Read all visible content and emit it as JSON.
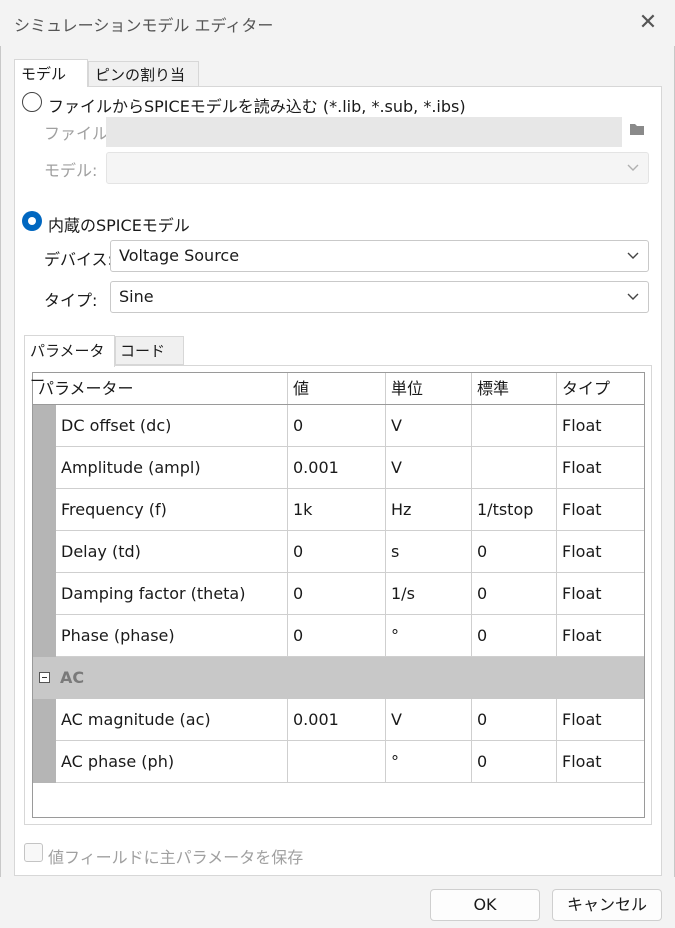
{
  "window": {
    "title": "シミュレーションモデル エディター"
  },
  "tabs": {
    "model": "モデル",
    "pins": "ピンの割り当て"
  },
  "file_source": {
    "radio_label": "ファイルからSPICEモデルを読み込む (*.lib, *.sub, *.ibs)",
    "file_label": "ファイル:",
    "file_value": "",
    "model_label": "モデル:",
    "model_value": ""
  },
  "builtin": {
    "radio_label": "内蔵のSPICEモデル",
    "device_label": "デバイス:",
    "device_value": "Voltage Source",
    "type_label": "タイプ:",
    "type_value": "Sine"
  },
  "inner_tabs": {
    "params": "パラメーター",
    "code": "コード"
  },
  "grid": {
    "headers": [
      "パラメーター",
      "値",
      "単位",
      "標準",
      "タイプ"
    ],
    "rows": [
      {
        "name": "DC offset (dc)",
        "value": "0",
        "unit": "V",
        "default": "",
        "type": "Float"
      },
      {
        "name": "Amplitude (ampl)",
        "value": "0.001",
        "unit": "V",
        "default": "",
        "type": "Float"
      },
      {
        "name": "Frequency (f)",
        "value": "1k",
        "unit": "Hz",
        "default": "1/tstop",
        "type": "Float"
      },
      {
        "name": "Delay (td)",
        "value": "0",
        "unit": "s",
        "default": "0",
        "type": "Float"
      },
      {
        "name": "Damping factor (theta)",
        "value": "0",
        "unit": "1/s",
        "default": "0",
        "type": "Float"
      },
      {
        "name": "Phase (phase)",
        "value": "0",
        "unit": "°",
        "default": "0",
        "type": "Float"
      }
    ],
    "group": "AC",
    "group_rows": [
      {
        "name": "AC magnitude (ac)",
        "value": "0.001",
        "unit": "V",
        "default": "0",
        "type": "Float"
      },
      {
        "name": "AC phase (ph)",
        "value": "",
        "unit": "°",
        "default": "0",
        "type": "Float"
      }
    ]
  },
  "save_option": "値フィールドに主パラメータを保存",
  "buttons": {
    "ok": "OK",
    "cancel": "キャンセル"
  },
  "icons": {
    "close": "close-icon",
    "folder": "folder-icon",
    "dropdown": "chevron-down-icon",
    "collapse": "minus-box-icon"
  },
  "colors": {
    "accent": "#0067c0",
    "gutter": "#b5b5b5",
    "group": "#c8c8c8"
  }
}
